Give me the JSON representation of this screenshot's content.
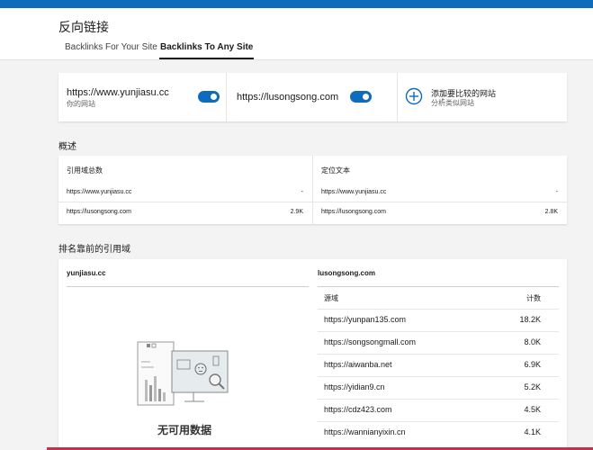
{
  "header": {
    "title": "反向链接",
    "tabs": [
      "Backlinks For Your Site",
      "Backlinks To Any Site"
    ],
    "active_tab": "Backlinks To Any Site"
  },
  "sites": {
    "primary": {
      "url": "https://www.yunjiasu.cc",
      "sublabel": "你的网站",
      "enabled": true
    },
    "competitor": {
      "url": "https://lusongsong.com",
      "enabled": true
    },
    "add": {
      "label": "添加要比较的网站",
      "sublabel": "分析类似网站"
    }
  },
  "overview": {
    "title": "概述",
    "referring_domains": {
      "title": "引用域总数",
      "rows": [
        {
          "site": "https://www.yunjiasu.cc",
          "value": "-"
        },
        {
          "site": "https://lusongsong.com",
          "value": "2.9K"
        }
      ]
    },
    "anchor_text": {
      "title": "定位文本",
      "rows": [
        {
          "site": "https://www.yunjiasu.cc",
          "value": "-"
        },
        {
          "site": "https://lusongsong.com",
          "value": "2.8K"
        }
      ]
    }
  },
  "top_domains": {
    "title": "排名靠前的引用域",
    "left": {
      "domain": "yunjiasu.cc",
      "empty_text": "无可用数据"
    },
    "right": {
      "domain": "lusongsong.com",
      "col_source": "源域",
      "col_count": "计数",
      "rows": [
        {
          "source": "https://yunpan135.com",
          "count": "18.2K"
        },
        {
          "source": "https://songsongmall.com",
          "count": "8.0K"
        },
        {
          "source": "https://aiwanba.net",
          "count": "6.9K"
        },
        {
          "source": "https://yidian9.cn",
          "count": "5.2K"
        },
        {
          "source": "https://cdz423.com",
          "count": "4.5K"
        },
        {
          "source": "https://wannianyixin.cn",
          "count": "4.1K"
        }
      ]
    }
  },
  "colors": {
    "accent": "#0f6cbd",
    "alert": "#c4314b"
  },
  "icons": [
    "toggle-on",
    "more-vertical-icon",
    "add-circle-icon",
    "empty-state-illustration"
  ]
}
